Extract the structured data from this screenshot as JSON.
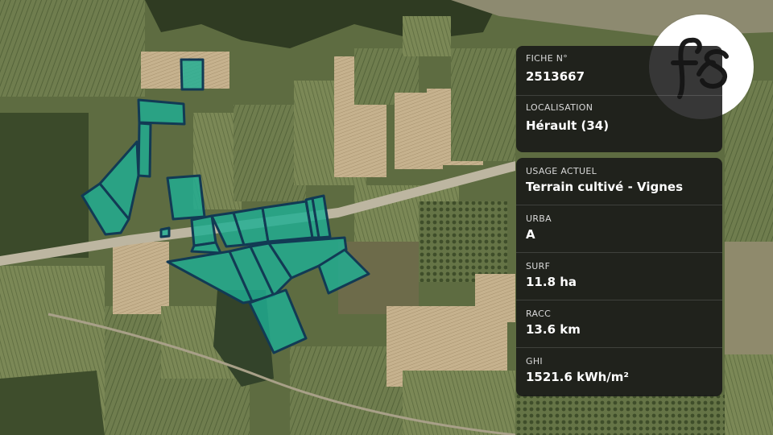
{
  "map": {
    "parcel_fill": "#1fae94",
    "parcel_stroke": "#123a54"
  },
  "fiche": {
    "label": "FICHE N°",
    "value": "2513667"
  },
  "localisation": {
    "label": "LOCALISATION",
    "value": "Hérault (34)"
  },
  "usage": {
    "label": "USAGE ACTUEL",
    "value": "Terrain cultivé - Vignes"
  },
  "urba": {
    "label": "URBA",
    "value": "A"
  },
  "surf": {
    "label": "SURF",
    "value": "11.8 ha"
  },
  "racc": {
    "label": "RACC",
    "value": "13.6 km"
  },
  "ghi": {
    "label": "GHI",
    "value": "1521.6 kWh/m²"
  },
  "logo": {
    "icon": "fs-monogram-logo"
  }
}
